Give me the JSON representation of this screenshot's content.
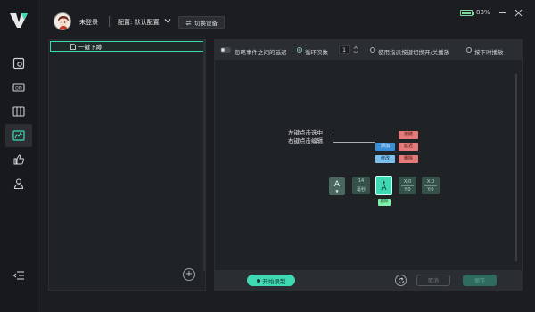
{
  "app": {
    "logo": "v-logo",
    "login_text": "未登录",
    "config_label": "配置: 默认配置",
    "switch_device_label": "切换设备",
    "battery_percent": "83%",
    "battery_level": 0.83,
    "accent_color": "#3fd9b4"
  },
  "sidebar": {
    "items": [
      {
        "icon": "settings-panel-icon"
      },
      {
        "icon": "dpi-icon"
      },
      {
        "icon": "keyboard-icon"
      },
      {
        "icon": "macro-icon"
      },
      {
        "icon": "thumbs-up-icon"
      },
      {
        "icon": "user-icon"
      }
    ],
    "collapse_icon": "collapse-menu-icon"
  },
  "macro_list": {
    "items": [
      {
        "label": "一键下蹲"
      }
    ]
  },
  "options": {
    "ignore_delay_label": "忽略事件之间的延迟",
    "loop_label": "循环次数",
    "loop_count": "1",
    "toggle_mode_label": "使用指派按键切换开/关播放",
    "hold_mode_label": "按下时播放"
  },
  "editor": {
    "hint_line1": "左键点击选中",
    "hint_line2": "右键点击编辑",
    "menu_left": [
      "添加",
      "修改"
    ],
    "menu_right": [
      "按键",
      "延迟",
      "删除"
    ],
    "key_a": "A",
    "delay_value": "14",
    "delay_unit": "毫秒",
    "selected_key": "A",
    "selected_tag": "删除",
    "coord_x1": "X:0",
    "coord_y1": "Y:0",
    "coord_x2": "X:0",
    "coord_y2": "Y:0"
  },
  "footer": {
    "record_label": "开始录制",
    "cancel_label": "取消",
    "save_label": "保存"
  }
}
